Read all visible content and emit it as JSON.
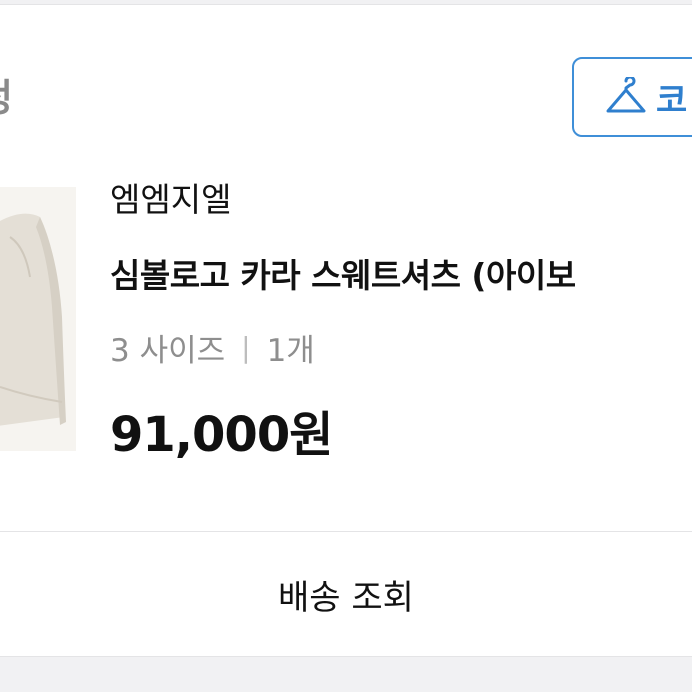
{
  "order": {
    "status_title": "정",
    "coordi_button_label": "코"
  },
  "product": {
    "brand": "엠엠지엘",
    "name": "심볼로고 카라 스웨트셔츠 (아이보",
    "size_label": "3 사이즈",
    "separator": "|",
    "quantity": "1개",
    "price": "91,000원",
    "image_icon": "sweatshirt-thumbnail"
  },
  "actions": {
    "shipping_label": "배송 조회"
  },
  "colors": {
    "accent": "#3f8fd8",
    "muted_text": "#8e8e8e",
    "background": "#f1f1f3"
  }
}
